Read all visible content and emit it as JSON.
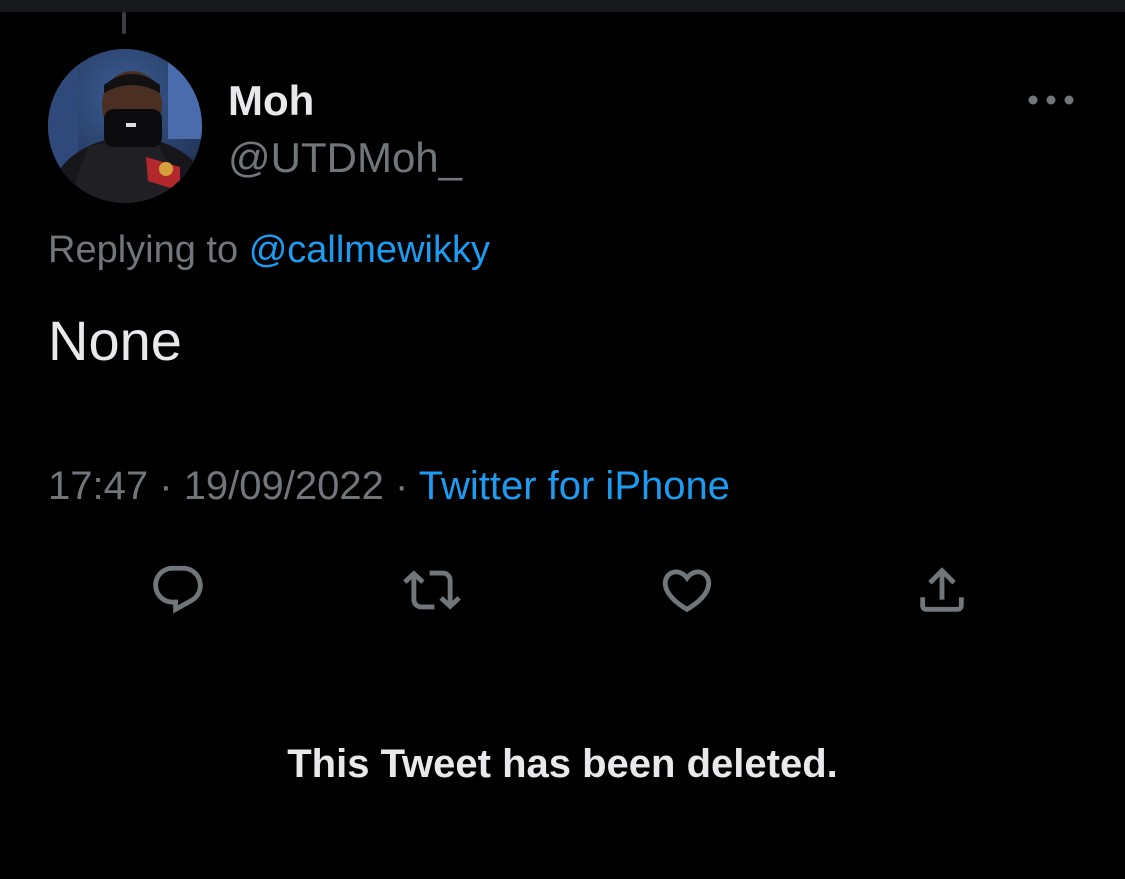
{
  "tweet": {
    "author": {
      "display_name": "Moh",
      "handle": "@UTDMoh_",
      "avatar_icon": "user-avatar-photo"
    },
    "reply_context": {
      "prefix": "Replying to",
      "mention": "@callmewikky"
    },
    "text": "None",
    "meta": {
      "time": "17:47",
      "separator": "·",
      "date": "19/09/2022",
      "source": "Twitter for iPhone"
    },
    "actions": {
      "reply_icon": "reply-icon",
      "retweet_icon": "retweet-icon",
      "like_icon": "heart-icon",
      "share_icon": "share-icon"
    },
    "more_icon": "more-options-icon"
  },
  "deleted_notice": "This Tweet has been deleted.",
  "colors": {
    "background": "#000000",
    "primary_text": "#e7e9ea",
    "secondary_text": "#71767b",
    "accent": "#1d9bf0"
  }
}
